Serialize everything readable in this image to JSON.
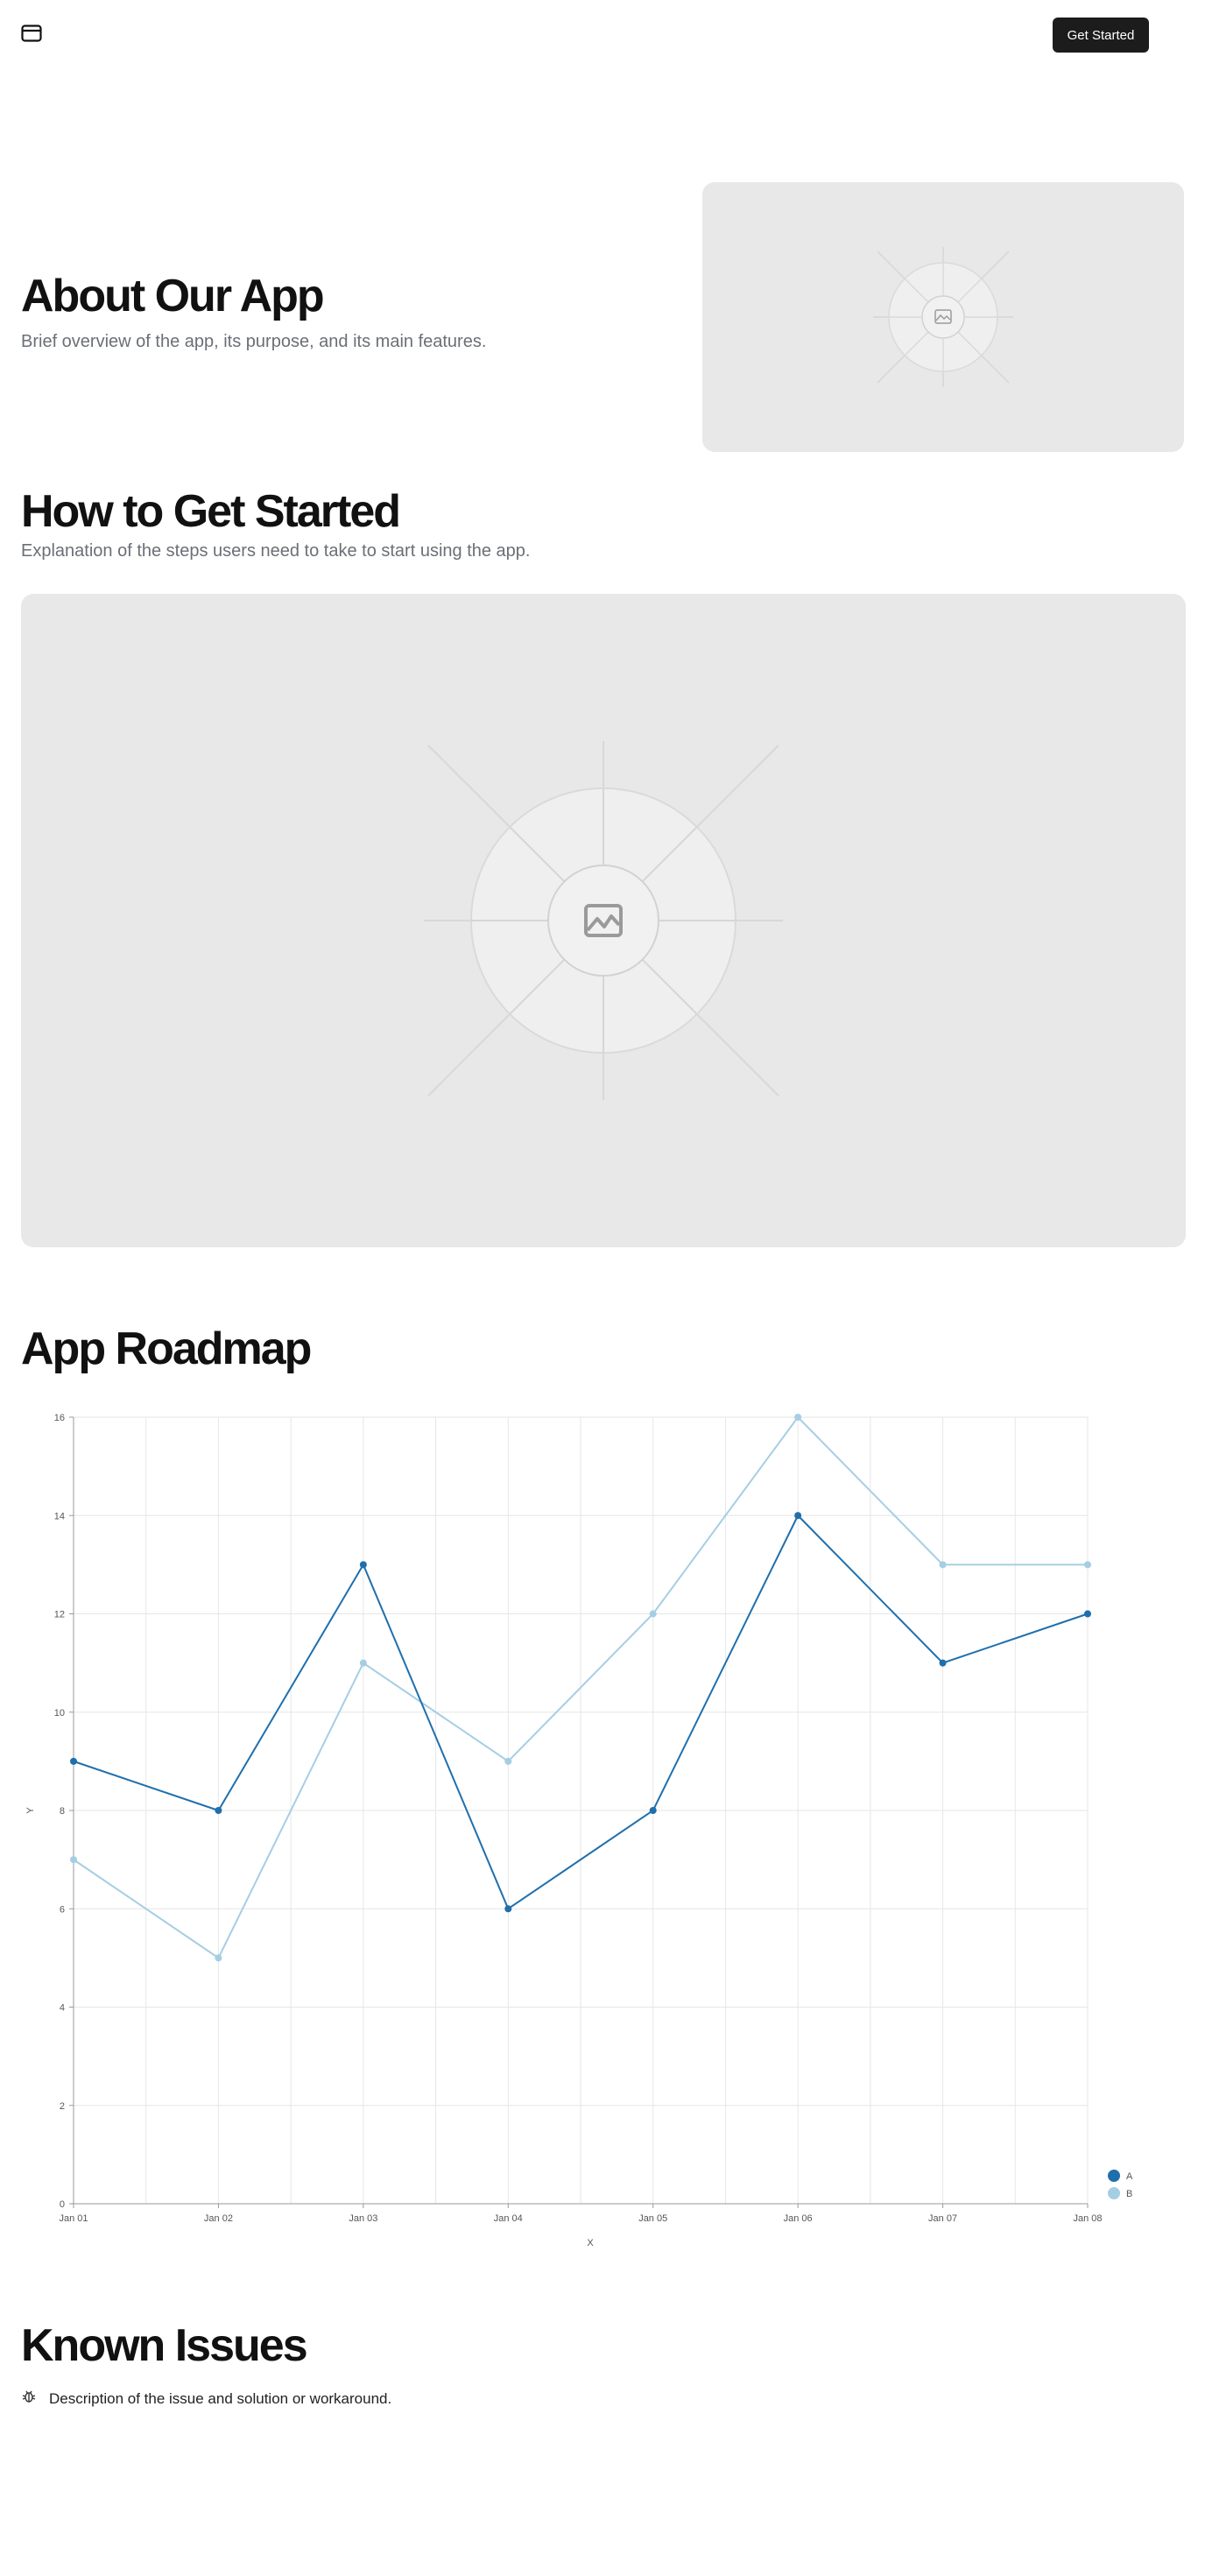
{
  "header": {
    "logo_icon": "browser-window-icon",
    "cta_label": "Get Started"
  },
  "about": {
    "title": "About Our App",
    "description": "Brief overview of the app, its purpose, and its main features.",
    "image_icon": "image-placeholder-icon"
  },
  "get_started": {
    "title": "How to Get Started",
    "description": "Explanation of the steps users need to take to start using the app.",
    "image_icon": "image-placeholder-icon"
  },
  "roadmap": {
    "title": "App Roadmap"
  },
  "chart_data": {
    "type": "line",
    "categories": [
      "Jan 01",
      "Jan 02",
      "Jan 03",
      "Jan 04",
      "Jan 05",
      "Jan 06",
      "Jan 07",
      "Jan 08"
    ],
    "series": [
      {
        "name": "A",
        "color": "#1f6fad",
        "values": [
          9,
          8,
          13,
          6,
          8,
          14,
          11,
          12
        ]
      },
      {
        "name": "B",
        "color": "#a6cee3",
        "values": [
          7,
          5,
          11,
          9,
          12,
          16,
          13,
          13
        ]
      }
    ],
    "yticks": [
      0,
      2,
      4,
      6,
      8,
      10,
      12,
      14,
      16
    ],
    "ylim": [
      0,
      16
    ],
    "xlabel": "X",
    "ylabel": "Y",
    "grid": true,
    "legend": "bottom-right"
  },
  "known_issues": {
    "title": "Known Issues",
    "items": [
      {
        "icon": "bug-icon",
        "text": "Description of the issue and solution or workaround."
      }
    ]
  }
}
